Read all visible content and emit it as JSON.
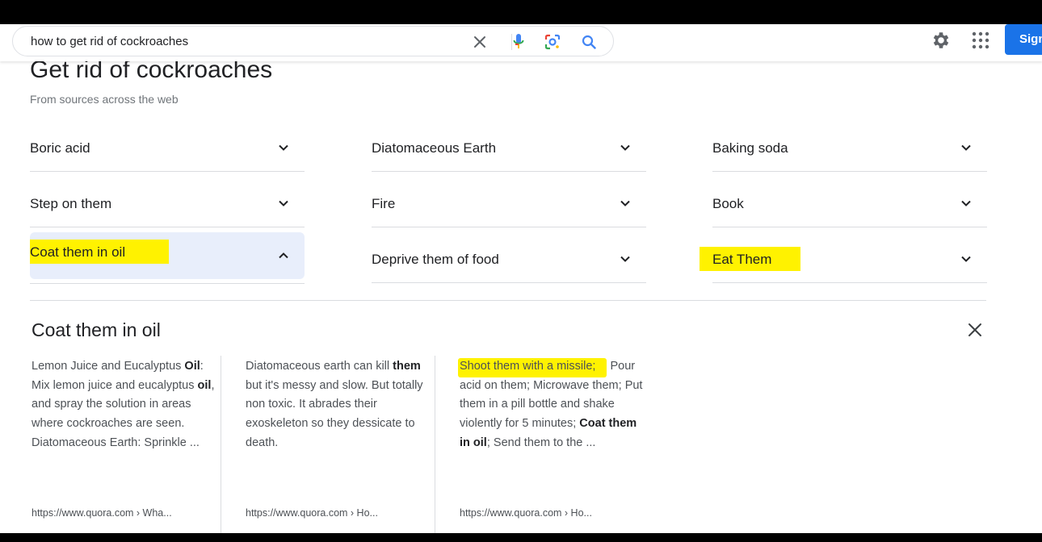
{
  "search": {
    "query": "how to get rid of cockroaches",
    "signin_label": "Sign"
  },
  "icons": {
    "clear": "close-icon",
    "voice": "microphone-icon",
    "lens": "google-lens-icon",
    "search": "search-icon",
    "settings": "gear-icon",
    "apps": "apps-grid-icon"
  },
  "colors": {
    "accent": "#1a73e8",
    "highlight": "#fff200",
    "active_bg": "#e8eefb"
  },
  "result": {
    "title": "Get rid of cockroaches",
    "subtitle": "From sources across the web",
    "items": [
      {
        "label": "Boric acid",
        "expanded": false
      },
      {
        "label": "Diatomaceous Earth",
        "expanded": false
      },
      {
        "label": "Baking soda",
        "expanded": false
      },
      {
        "label": "Step on them",
        "expanded": false
      },
      {
        "label": "Fire",
        "expanded": false
      },
      {
        "label": "Book",
        "expanded": false
      },
      {
        "label": "Coat them in oil",
        "expanded": true,
        "highlighted": true
      },
      {
        "label": "Deprive them of food",
        "expanded": false
      },
      {
        "label": "Eat Them",
        "expanded": false,
        "highlighted": true
      }
    ]
  },
  "panel": {
    "title": "Coat them in oil",
    "sources": [
      {
        "snippet_parts": [
          "Lemon Juice and Eucalyptus ",
          "Oil",
          ": Mix lemon juice and eucalyptus ",
          "oil",
          ", and spray the solution in areas where cockroaches are seen. Diatomaceous Earth: Sprinkle ..."
        ],
        "url": "https://www.quora.com › Wha..."
      },
      {
        "snippet_parts": [
          "Diatomaceous earth can kill ",
          "them",
          " but it's messy and slow. But totally non toxic. It abrades their exoskeleton so they dessicate to death."
        ],
        "url": "https://www.quora.com › Ho..."
      },
      {
        "snippet_parts": [
          "Shoot them with a missile;",
          " Pour acid on them; Microwave them; Put them in a pill bottle and shake violently for 5 minutes; ",
          "Coat them in oil",
          "; Send them to the ..."
        ],
        "url": "https://www.quora.com › Ho..."
      }
    ]
  }
}
